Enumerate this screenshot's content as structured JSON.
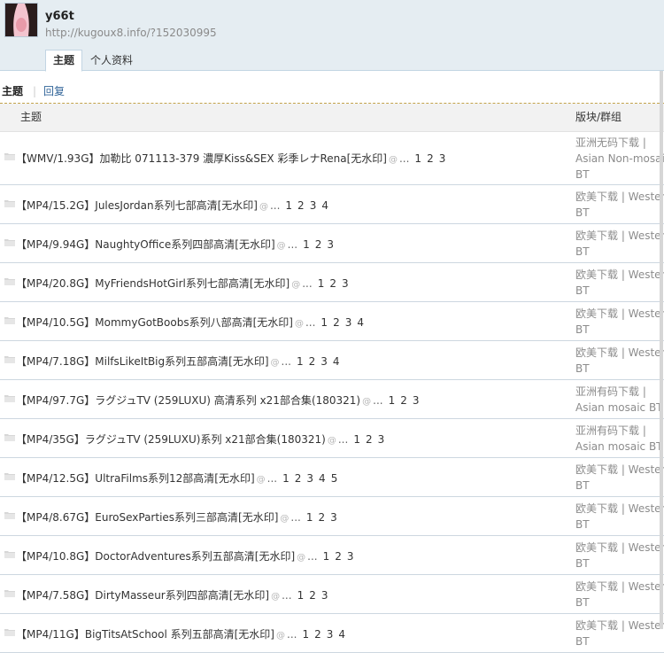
{
  "profile": {
    "username": "y66t",
    "url": "http://kugoux8.info/?152030995"
  },
  "tabs": [
    {
      "label": "主题",
      "active": true
    },
    {
      "label": "个人资料",
      "active": false
    }
  ],
  "subnav": {
    "active": "主题",
    "separator": "|",
    "link": "回复"
  },
  "table": {
    "col_topic": "主题",
    "col_forum": "版块/群组"
  },
  "threads": [
    {
      "title": "【WMV/1.93G】加勒比 071113-379 濃厚Kiss&SEX 彩季レナRena[无水印]",
      "pages": [
        "1",
        "2",
        "3"
      ],
      "forum": [
        "亚洲无码下载 |",
        "Asian Non-mosaic",
        "BT"
      ]
    },
    {
      "title": "【MP4/15.2G】JulesJordan系列七部高清[无水印]",
      "pages": [
        "1",
        "2",
        "3",
        "4"
      ],
      "forum": [
        "欧美下载 | Western",
        "BT"
      ]
    },
    {
      "title": "【MP4/9.94G】NaughtyOffice系列四部高清[无水印]",
      "pages": [
        "1",
        "2",
        "3"
      ],
      "forum": [
        "欧美下载 | Western",
        "BT"
      ]
    },
    {
      "title": "【MP4/20.8G】MyFriendsHotGirl系列七部高清[无水印]",
      "pages": [
        "1",
        "2",
        "3"
      ],
      "forum": [
        "欧美下载 | Western",
        "BT"
      ]
    },
    {
      "title": "【MP4/10.5G】MommyGotBoobs系列八部高清[无水印]",
      "pages": [
        "1",
        "2",
        "3",
        "4"
      ],
      "forum": [
        "欧美下载 | Western",
        "BT"
      ]
    },
    {
      "title": "【MP4/7.18G】MilfsLikeItBig系列五部高清[无水印]",
      "pages": [
        "1",
        "2",
        "3",
        "4"
      ],
      "forum": [
        "欧美下载 | Western",
        "BT"
      ]
    },
    {
      "title": "【MP4/97.7G】ラグジュTV (259LUXU) 高清系列 x21部合集(180321)",
      "pages": [
        "1",
        "2",
        "3"
      ],
      "forum": [
        "亚洲有码下载 |",
        "Asian mosaic BT"
      ]
    },
    {
      "title": "【MP4/35G】ラグジュTV (259LUXU)系列 x21部合集(180321)",
      "pages": [
        "1",
        "2",
        "3"
      ],
      "forum": [
        "亚洲有码下载 |",
        "Asian mosaic BT"
      ]
    },
    {
      "title": "【MP4/12.5G】UltraFilms系列12部高清[无水印]",
      "pages": [
        "1",
        "2",
        "3",
        "4",
        "5"
      ],
      "forum": [
        "欧美下载 | Western",
        "BT"
      ]
    },
    {
      "title": "【MP4/8.67G】EuroSexParties系列三部高清[无水印]",
      "pages": [
        "1",
        "2",
        "3"
      ],
      "forum": [
        "欧美下载 | Western",
        "BT"
      ]
    },
    {
      "title": "【MP4/10.8G】DoctorAdventures系列五部高清[无水印]",
      "pages": [
        "1",
        "2",
        "3"
      ],
      "forum": [
        "欧美下载 | Western",
        "BT"
      ]
    },
    {
      "title": "【MP4/7.58G】DirtyMasseur系列四部高清[无水印]",
      "pages": [
        "1",
        "2",
        "3"
      ],
      "forum": [
        "欧美下载 | Western",
        "BT"
      ]
    },
    {
      "title": "【MP4/11G】BigTitsAtSchool 系列五部高清[无水印]",
      "pages": [
        "1",
        "2",
        "3",
        "4"
      ],
      "forum": [
        "欧美下载 | Western",
        "BT"
      ]
    }
  ],
  "glyphs": {
    "attachment": "@",
    "ellipsis": "..."
  },
  "colors": {
    "header_bg": "#e5edf2",
    "link": "#336699",
    "muted": "#8c8c8c"
  }
}
